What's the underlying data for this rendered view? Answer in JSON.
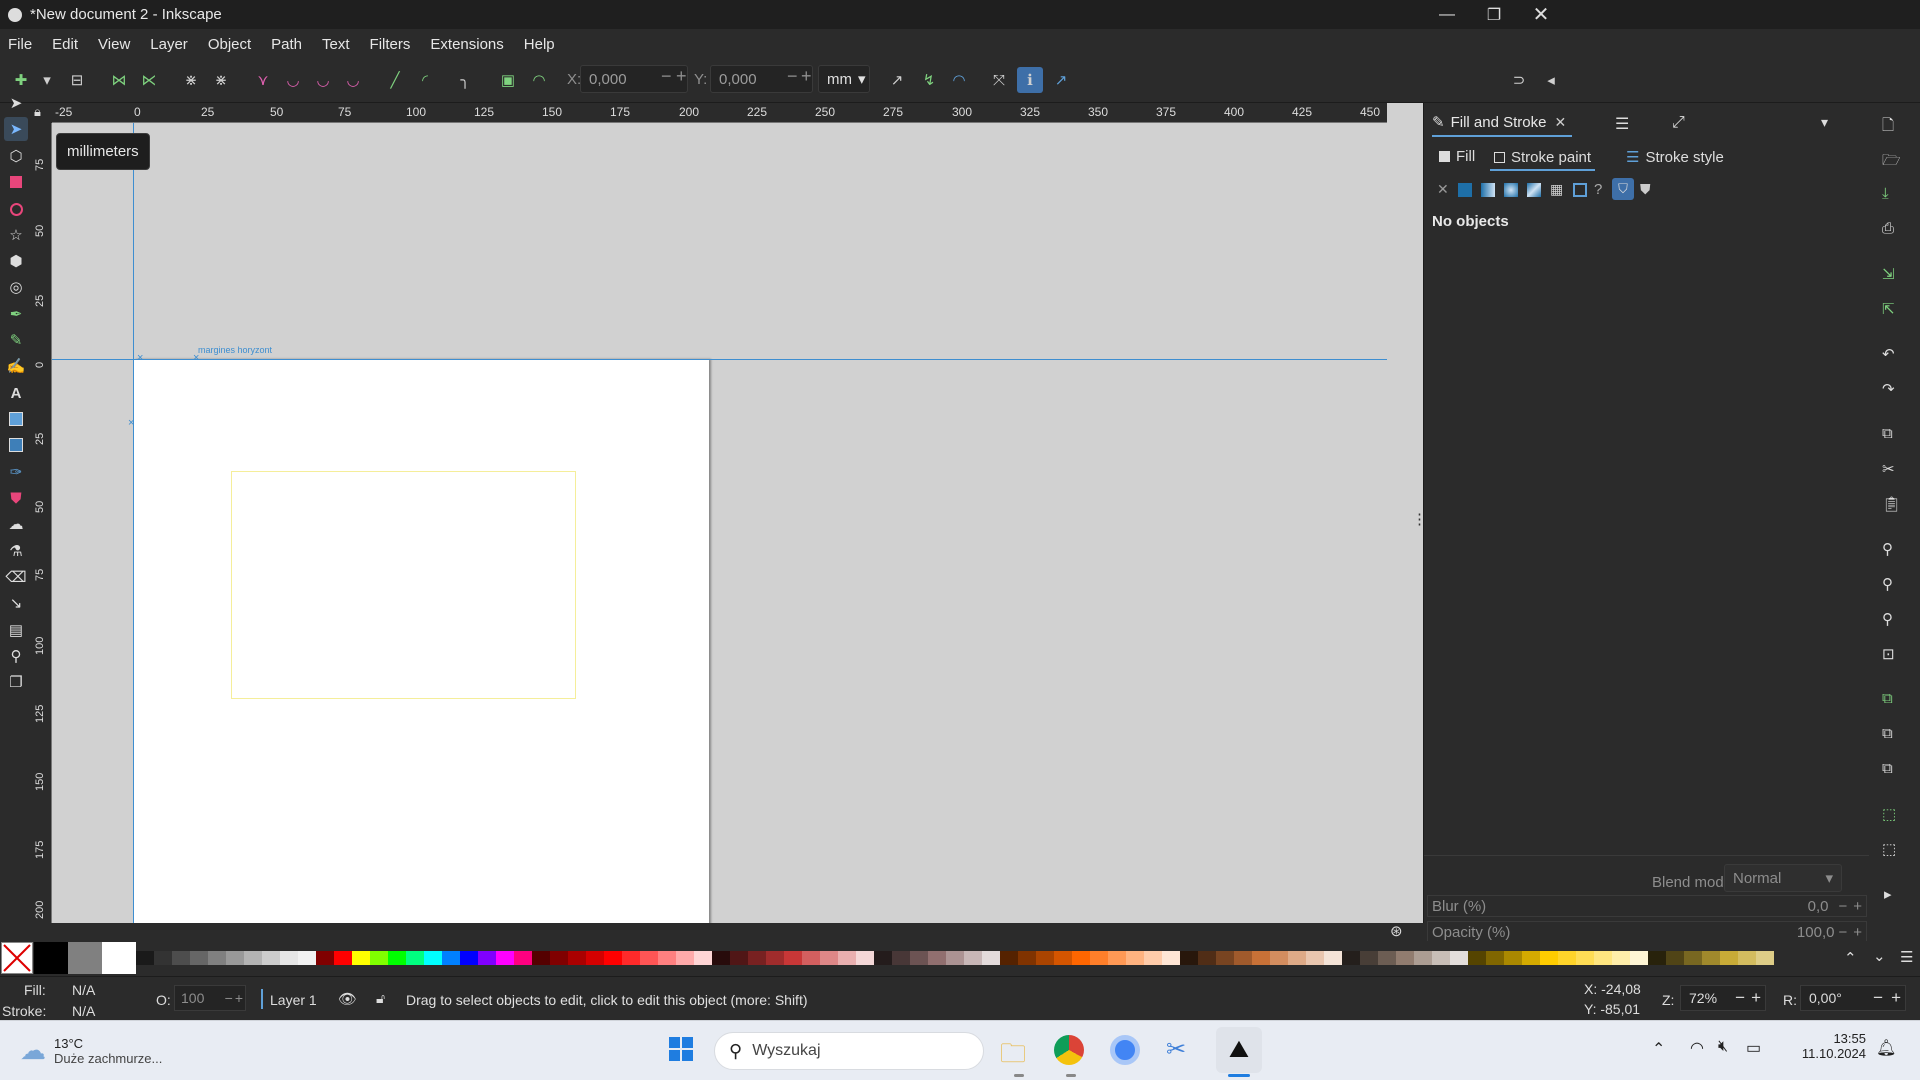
{
  "window": {
    "title": "*New document 2 - Inkscape",
    "controls": [
      "minimize-icon",
      "restore-icon",
      "close-icon"
    ]
  },
  "menu": [
    "File",
    "Edit",
    "View",
    "Layer",
    "Object",
    "Path",
    "Text",
    "Filters",
    "Extensions",
    "Help"
  ],
  "toolbar": {
    "x_label": "X:",
    "x_value": "0,000",
    "y_label": "Y:",
    "y_value": "0,000",
    "unit": "mm"
  },
  "tooltip": "millimeters",
  "ruler": {
    "horizontal": [
      "-25",
      "0",
      "25",
      "50",
      "75",
      "100",
      "125",
      "150",
      "175",
      "200",
      "225",
      "250",
      "275",
      "300",
      "325",
      "350",
      "375",
      "400",
      "425",
      "450"
    ],
    "vertical": [
      "75",
      "50",
      "25",
      "0",
      "25",
      "50",
      "75",
      "100",
      "125",
      "150",
      "175",
      "200"
    ]
  },
  "canvas": {
    "guide_label": "margines horyzont",
    "colors": {
      "desk": "#d1d1d1",
      "page": "#ffffff",
      "guide": "#3e8ed0",
      "rect_stroke": "#f5ee9a"
    }
  },
  "panel": {
    "tab_label": "Fill and Stroke",
    "subtabs": [
      "Fill",
      "Stroke paint",
      "Stroke style"
    ],
    "active_subtab": "Stroke paint",
    "message": "No objects",
    "blend_label": "Blend mode:",
    "blend_value": "Normal",
    "blur_label": "Blur (%)",
    "blur_value": "0,0",
    "opacity_label": "Opacity (%)",
    "opacity_value": "100,0"
  },
  "palette": {
    "swatches": [
      "#000000",
      "#808080",
      "#ffffff",
      "#1a1a1a",
      "#333333",
      "#4d4d4d",
      "#666666",
      "#808080",
      "#999999",
      "#b3b3b3",
      "#cccccc",
      "#e6e6e6",
      "#f2f2f2",
      "#800000",
      "#ff0000",
      "#ffff00",
      "#80ff00",
      "#00ff00",
      "#00ff80",
      "#00ffff",
      "#0080ff",
      "#0000ff",
      "#8000ff",
      "#ff00ff",
      "#ff0080",
      "#550000",
      "#800000",
      "#aa0000",
      "#d40000",
      "#ff0000",
      "#ff2a2a",
      "#ff5555",
      "#ff8080",
      "#ffaaaa",
      "#ffd5d5",
      "#280b0b",
      "#501616",
      "#782121",
      "#a02c2c",
      "#c83737",
      "#d35f5f",
      "#de8787",
      "#e9afaf",
      "#f4d7d7",
      "#241c1c",
      "#483737",
      "#6c5353",
      "#916f6f",
      "#ac9393",
      "#c8b7b7",
      "#e3dbdb",
      "#552200",
      "#803300",
      "#aa4400",
      "#d45500",
      "#ff6600",
      "#ff7f2a",
      "#ff9955",
      "#ffb380",
      "#ffccaa",
      "#ffe6d5",
      "#28170b",
      "#502d16",
      "#784421",
      "#a05a2c",
      "#c87137",
      "#d38d5f",
      "#deaa87",
      "#e9c6af",
      "#f4e3d7",
      "#241f1c",
      "#483e37",
      "#6c5d53",
      "#917c6f",
      "#ac9d93",
      "#c8beb7",
      "#e3dedb",
      "#554400",
      "#806600",
      "#aa8800",
      "#d4aa00",
      "#ffcc00",
      "#ffd42a",
      "#ffdd55",
      "#ffe680",
      "#ffeeaa",
      "#fff6d5",
      "#28220b",
      "#504416",
      "#786721",
      "#a0892c",
      "#c8ab37",
      "#d3bc5f",
      "#decd87"
    ]
  },
  "status": {
    "fill_label": "Fill:",
    "fill_value": "N/A",
    "stroke_label": "Stroke:",
    "stroke_value": "N/A",
    "opacity_label": "O:",
    "opacity_value": "100",
    "layer": "Layer 1",
    "message": "Drag to select objects to edit, click to edit this object (more: Shift)",
    "cursor_x": "X: -24,08",
    "cursor_y": "Y: -85,01",
    "zoom_label": "Z:",
    "zoom_value": "72%",
    "rotation_label": "R:",
    "rotation_value": "0,00°"
  },
  "taskbar": {
    "temperature": "13°C",
    "weather": "Duże zachmurze...",
    "search_placeholder": "Wyszukaj",
    "time": "13:55",
    "date": "11.10.2024"
  }
}
